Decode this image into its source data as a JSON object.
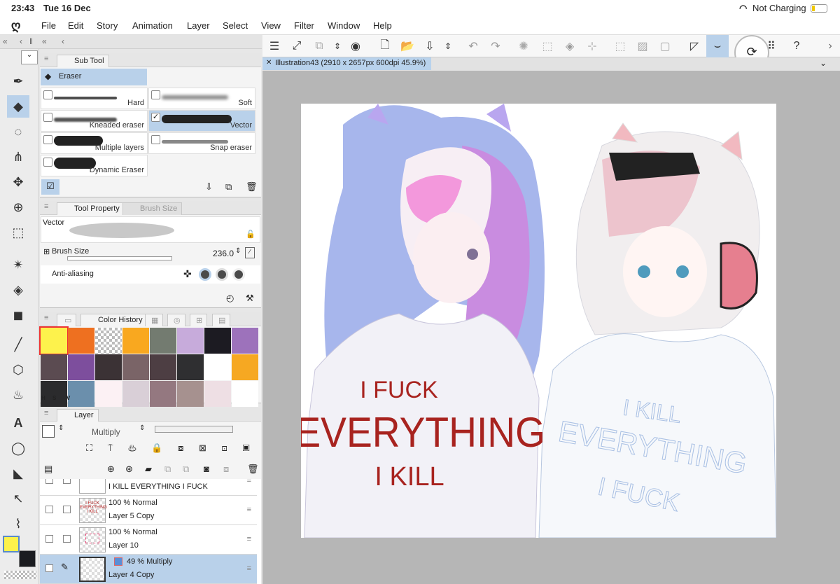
{
  "status": {
    "time": "23:43",
    "date": "Tue 16 Dec",
    "battery": "Not Charging"
  },
  "menu": [
    "File",
    "Edit",
    "Story",
    "Animation",
    "Layer",
    "Select",
    "View",
    "Filter",
    "Window",
    "Help"
  ],
  "subtool": {
    "panel_title": "Sub Tool",
    "group": "Eraser",
    "brushes": [
      {
        "label": "Hard",
        "checked": false
      },
      {
        "label": "Soft",
        "checked": false
      },
      {
        "label": "Kneaded eraser",
        "checked": false
      },
      {
        "label": "Vector",
        "checked": true
      },
      {
        "label": "Multiple layers",
        "checked": false
      },
      {
        "label": "Snap eraser",
        "checked": false
      },
      {
        "label": "Dynamic Eraser",
        "checked": false
      }
    ]
  },
  "toolprop": {
    "tab1": "Tool Property",
    "tab2": "Brush Size",
    "preview_label": "Vector",
    "brush_size_label": "Brush Size",
    "brush_size_value": "236.0",
    "antialias_label": "Anti-aliasing"
  },
  "color": {
    "tab": "Color History",
    "swatches": [
      "#fdf24c",
      "#ee7020",
      "checker",
      "#f9a81f",
      "#737b70",
      "#c7abdb",
      "#1c1b22",
      "#9d72bb",
      "#5b4b51",
      "#7d4e9d",
      "#3b3235",
      "#7a6467",
      "#4d3e43",
      "#2f2f31",
      "#ffffff",
      "#f6a822",
      "#2b2b2d",
      "#6b8fac",
      "#fcf1f4",
      "#d9cfd7",
      "#947880",
      "#a6918f",
      "#eedfe4",
      "#ffffff"
    ],
    "hsv": [
      "H",
      "S",
      "V"
    ],
    "main": "#fdf24c",
    "sub": "#1b1c20"
  },
  "layer": {
    "tab": "Layer",
    "blend": "Multiply",
    "rows": [
      {
        "l1": "",
        "l2": "I KILL  EVERYTHING I FUCK",
        "selected": false
      },
      {
        "l1": "100 %  Normal",
        "l2": "Layer 5 Copy",
        "selected": false
      },
      {
        "l1": "100 %  Normal",
        "l2": "Layer 10",
        "selected": false
      },
      {
        "l1": "49 %  Multiply",
        "l2": "Layer 4 Copy",
        "selected": true
      }
    ]
  },
  "document": {
    "tab": "Illustration43 (2910 x 2657px 600dpi 45.9%)"
  },
  "artwork": {
    "left_shirt": [
      "I FUCK",
      "EVERYTHING",
      "I KILL"
    ],
    "right_shirt": [
      "I KILL",
      "EVERYTHING",
      "I FUCK"
    ]
  }
}
